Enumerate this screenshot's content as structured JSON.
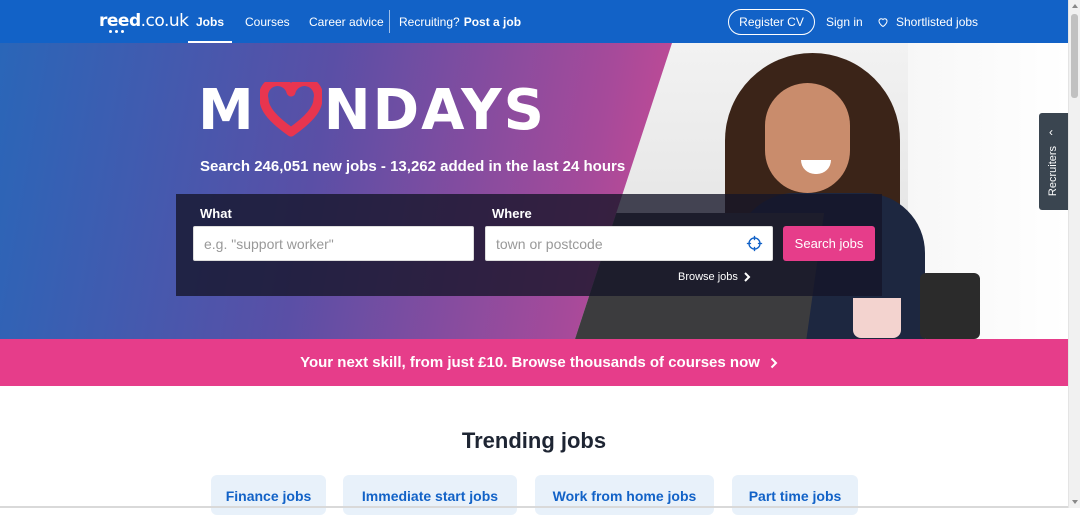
{
  "header": {
    "logo_main": "reed",
    "logo_suffix": ".co.uk",
    "nav_jobs": "Jobs",
    "nav_courses": "Courses",
    "nav_career": "Career advice",
    "recruiting_prefix": "Recruiting?",
    "recruiting_link": "Post a job",
    "register_cv": "Register CV",
    "sign_in": "Sign in",
    "shortlisted": "Shortlisted jobs",
    "bg_color": "#1262c7"
  },
  "hero": {
    "headline_left": "M",
    "headline_right": "NDAYS",
    "subline": "Search 246,051 new jobs - 13,262 added in the last 24 hours",
    "what_label": "What",
    "what_placeholder": "e.g. \"support worker\"",
    "where_label": "Where",
    "where_placeholder": "town or postcode",
    "search_button": "Search jobs",
    "browse_jobs": "Browse jobs",
    "accent_color": "#e63d8a"
  },
  "side_tab": {
    "label": "Recruiters",
    "icon": "chevron-left-icon"
  },
  "banner": {
    "text": "Your next skill, from just £10. Browse thousands of courses now"
  },
  "trending": {
    "title": "Trending jobs",
    "chips": [
      "Finance jobs",
      "Immediate start jobs",
      "Work from home jobs",
      "Part time jobs"
    ]
  }
}
